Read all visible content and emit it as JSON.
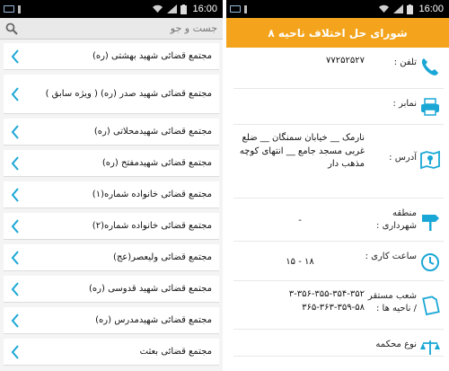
{
  "statusbar": {
    "time": "16:00"
  },
  "left": {
    "search": {
      "placeholder": "جست و جو"
    },
    "items": [
      {
        "label": "مجتمع قضائی شهید بهشتی (ره)"
      },
      {
        "label": "مجتمع قضائی شهید صدر (ره) ( ویژه سابق )"
      },
      {
        "label": "مجتمع قضائی شهیدمحلاتی (ره)"
      },
      {
        "label": "مجتمع قضائی شهیدمفتح (ره)"
      },
      {
        "label": "مجتمع قضائی خانواده شماره(۱)"
      },
      {
        "label": "مجتمع قضائی خانواده شماره(۲)"
      },
      {
        "label": "مجتمع قضائی ولیعصر(عج)"
      },
      {
        "label": "مجتمع قضائی شهید قدوسی (ره)"
      },
      {
        "label": "مجتمع قضائی شهیدمدرس (ره)"
      },
      {
        "label": "مجتمع قضائی بعثت"
      }
    ]
  },
  "right": {
    "title": "شورای حل اختلاف ناحیه ۸",
    "rows": [
      {
        "label": "تلفن :",
        "value": "۷۷۲۵۲۵۲۷",
        "icon": "phone-icon",
        "color": "#1aa7d6"
      },
      {
        "label": "نمابر :",
        "value": "",
        "icon": "fax-icon",
        "color": "#1aa7d6"
      },
      {
        "label": "آدرس :",
        "value": "نارمک __ خیابان سمنگان __ ضلع غربی مسجد جامع __ انتهای کوچه مذهب دار",
        "icon": "map-icon",
        "color": "#1aa7d6"
      },
      {
        "label": "منطقه شهرداری :",
        "value": "-",
        "icon": "signpost-icon",
        "color": "#1aa7d6"
      },
      {
        "label": "ساعت کاری :",
        "value": "۱۸ - ۱۵",
        "icon": "clock-icon",
        "color": "#1aa7d6"
      },
      {
        "label": "شعب مستقر / ناحیه ها :",
        "value": "۳-۳۵۶-۳۵۵-۳۵۴-۳۵۲ ۳۶۵-۳۶۳-۳۵۹-۵۸",
        "icon": "document-icon",
        "color": "#1aa7d6"
      },
      {
        "label": "نوع محکمه",
        "value": "",
        "icon": "scales-icon",
        "color": "#1aa7d6"
      }
    ]
  }
}
